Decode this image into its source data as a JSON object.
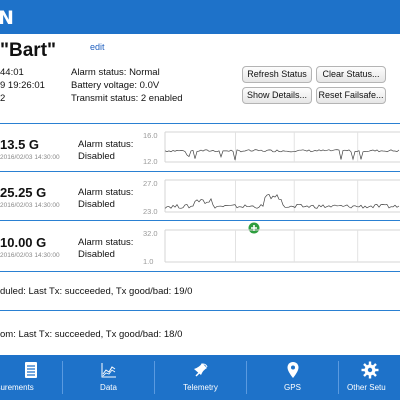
{
  "app": {
    "brand": "N"
  },
  "device": {
    "title": "\"Bart\"",
    "edit_label": "edit",
    "info_left": [
      "44:01",
      "9 19:26:01",
      "2"
    ],
    "alarm_status": "Alarm status: Normal",
    "battery_voltage": "Battery voltage: 0.0V",
    "transmit_status": "Transmit status: 2 enabled"
  },
  "actions": {
    "refresh_status": "Refresh Status",
    "clear_status": "Clear Status...",
    "show_details": "Show Details...",
    "reset_failsafe": "Reset Failsafe..."
  },
  "sensors": [
    {
      "value": "13.5 G",
      "timestamp": "2016/02/03 14:30:00",
      "alarm_label": "Alarm status:",
      "alarm_state": "Disabled",
      "chart": {
        "ymax_label": "16.0",
        "ymin_label": "12.0",
        "ymin": 12.0,
        "ymax": 16.0,
        "baseline": 13.5,
        "amplitude": 0.15,
        "line_color": "#444444"
      }
    },
    {
      "value": "25.25 G",
      "timestamp": "2016/02/03 14:30:00",
      "alarm_label": "Alarm status:",
      "alarm_state": "Disabled",
      "chart": {
        "ymax_label": "27.0",
        "ymin_label": "23.0",
        "ymin": 23.0,
        "ymax": 27.0,
        "baseline": 23.7,
        "amplitude": 0.25,
        "line_color": "#444444"
      }
    },
    {
      "value": "10.00 G",
      "timestamp": "2016/02/03 14:30:00",
      "alarm_label": "Alarm status:",
      "alarm_state": "Disabled",
      "chart": {
        "ymax_label": "32.0",
        "ymin_label": "1.0",
        "ymin": 1.0,
        "ymax": 32.0,
        "baseline": null,
        "amplitude": 0,
        "line_color": "#444444"
      }
    }
  ],
  "transmissions": [
    "duled:  Last Tx: succeeded, Tx good/bad: 19/0",
    "om:  Last Tx: succeeded, Tx good/bad: 18/0"
  ],
  "nav": [
    {
      "label": "asurements",
      "icon": "list-icon"
    },
    {
      "label": "Data",
      "icon": "chart-icon"
    },
    {
      "label": "Telemetry",
      "icon": "satellite-icon"
    },
    {
      "label": "GPS",
      "icon": "location-pin-icon"
    },
    {
      "label": "Other Setu",
      "icon": "gear-icon"
    }
  ],
  "colors": {
    "accent": "#1e72c9",
    "divider": "#2a80d2",
    "plus_badge": "#2e9e3e"
  }
}
